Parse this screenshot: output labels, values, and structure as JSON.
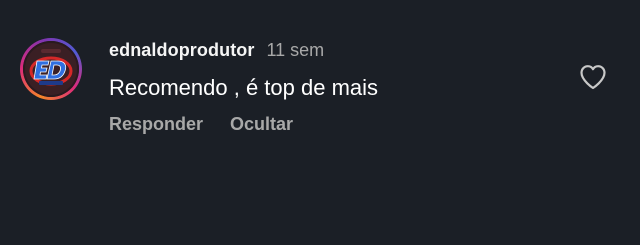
{
  "comment": {
    "avatar": {
      "icon": "ed-logo-avatar",
      "ring_colors": [
        "#f58529",
        "#dd2a7b",
        "#8134af",
        "#515bd4"
      ]
    },
    "username": "ednaldoprodutor",
    "time": "11 sem",
    "text": "Recomendo , é top de mais",
    "actions": {
      "reply": "Responder",
      "hide": "Ocultar"
    },
    "like_icon": "heart-outline-icon"
  },
  "colors": {
    "background": "#1b1f26",
    "text": "#ffffff",
    "secondary": "#a8a8a8"
  }
}
